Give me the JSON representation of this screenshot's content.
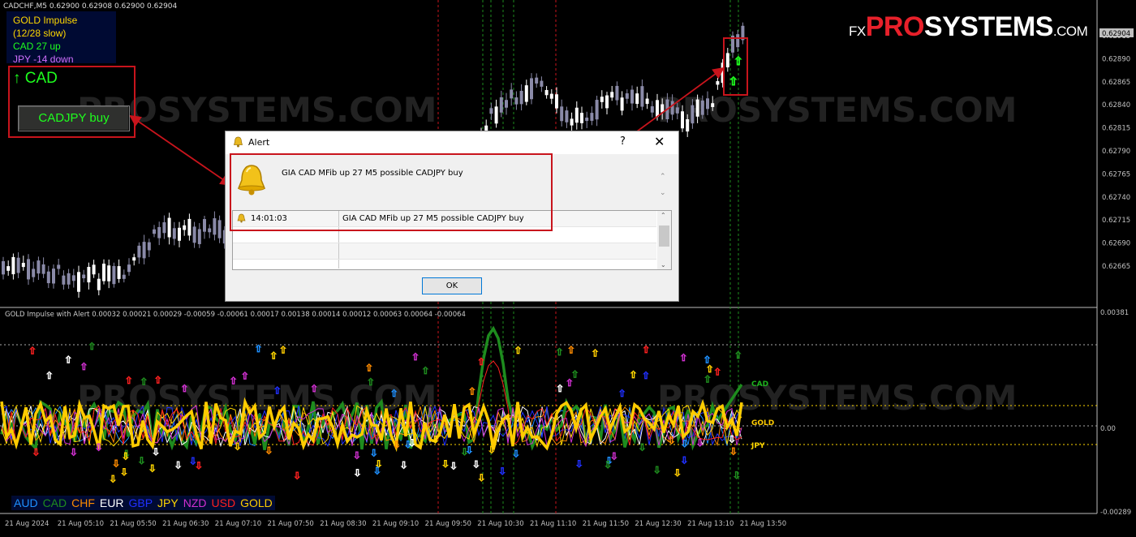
{
  "chart": {
    "symbol_header": "CADCHF,M5  0.62900 0.62908 0.62900 0.62904",
    "current_price": "0.62904",
    "price_ticks": [
      "0.62915",
      "0.62890",
      "0.62865",
      "0.62840",
      "0.62815",
      "0.62790",
      "0.62765",
      "0.62740",
      "0.62715",
      "0.62690",
      "0.62665"
    ],
    "indicator_ticks": [
      "0.00381",
      "0.00",
      "-0.00289"
    ],
    "time_labels": [
      "21 Aug 2024",
      "21 Aug 05:10",
      "21 Aug 05:50",
      "21 Aug 06:30",
      "21 Aug 07:10",
      "21 Aug 07:50",
      "21 Aug 08:30",
      "21 Aug 09:10",
      "21 Aug 09:50",
      "21 Aug 10:30",
      "21 Aug 11:10",
      "21 Aug 11:50",
      "21 Aug 12:30",
      "21 Aug 13:10",
      "21 Aug 13:50"
    ],
    "indicator_title": "GOLD Impulse with Alert  0.00032 0.00021 0.00029 -0.00059 -0.00061 0.00017 0.00138 0.00014 0.00012 0.00063 0.00064 -0.00064",
    "series_end_labels": [
      "CAD",
      "GOLD",
      "JPY"
    ],
    "colors": {
      "bull": "#ffffff",
      "bear": "#8a8aa8",
      "grid_red": "#c8141c",
      "grid_green": "#1e8c1e",
      "axis": "#c0c0c0"
    }
  },
  "info": {
    "line1": "GOLD Impulse",
    "line2": "(12/28 slow)",
    "line3": "CAD 27 up",
    "line4": "JPY -14 down",
    "signal_arrow": "↑",
    "signal_label": "CAD",
    "trade_button": "CADJPY buy"
  },
  "logo": {
    "fx": "FX",
    "pro": "PRO",
    "systems": "SYSTEMS",
    "com": ".COM"
  },
  "watermark": "PROSYSTEMS.COM",
  "legend": [
    {
      "label": "AUD",
      "color": "#1e90ff"
    },
    {
      "label": "CAD",
      "color": "#1e8c1e"
    },
    {
      "label": "CHF",
      "color": "#ff8c00"
    },
    {
      "label": "EUR",
      "color": "#ffffff"
    },
    {
      "label": "GBP",
      "color": "#2030ff"
    },
    {
      "label": "JPY",
      "color": "#ffd700"
    },
    {
      "label": "NZD",
      "color": "#d030d0"
    },
    {
      "label": "USD",
      "color": "#ff2020"
    },
    {
      "label": "GOLD",
      "color": "#ffcc00"
    }
  ],
  "alert": {
    "title": "Alert",
    "help": "?",
    "close": "✕",
    "message": "GIA CAD MFib up 27 M5 possible CADJPY buy",
    "rows": [
      {
        "time": "14:01:03",
        "message": "GIA CAD MFib up 27 M5 possible CADJPY buy"
      }
    ],
    "ok_label": "OK"
  }
}
